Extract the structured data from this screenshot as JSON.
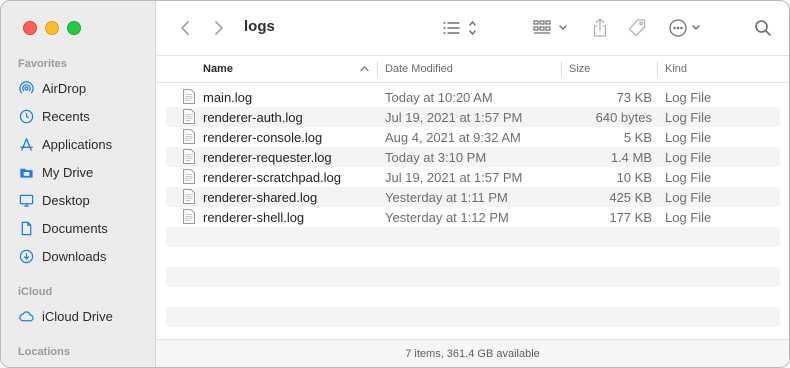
{
  "sidebar": {
    "favorites_title": "Favorites",
    "items": [
      {
        "label": "AirDrop",
        "icon": "airdrop-icon"
      },
      {
        "label": "Recents",
        "icon": "clock-icon"
      },
      {
        "label": "Applications",
        "icon": "applications-icon"
      },
      {
        "label": "My Drive",
        "icon": "folder-icon"
      },
      {
        "label": "Desktop",
        "icon": "desktop-icon"
      },
      {
        "label": "Documents",
        "icon": "document-icon"
      },
      {
        "label": "Downloads",
        "icon": "download-icon"
      }
    ],
    "icloud_title": "iCloud",
    "icloud_items": [
      {
        "label": "iCloud Drive",
        "icon": "cloud-icon"
      }
    ],
    "locations_title": "Locations"
  },
  "toolbar": {
    "title": "logs"
  },
  "columns": {
    "name": "Name",
    "date": "Date Modified",
    "size": "Size",
    "kind": "Kind"
  },
  "files": [
    {
      "name": "main.log",
      "date": "Today at 10:20 AM",
      "size": "73 KB",
      "kind": "Log File"
    },
    {
      "name": "renderer-auth.log",
      "date": "Jul 19, 2021 at 1:57 PM",
      "size": "640 bytes",
      "kind": "Log File"
    },
    {
      "name": "renderer-console.log",
      "date": "Aug 4, 2021 at 9:32 AM",
      "size": "5 KB",
      "kind": "Log File"
    },
    {
      "name": "renderer-requester.log",
      "date": "Today at 3:10 PM",
      "size": "1.4 MB",
      "kind": "Log File"
    },
    {
      "name": "renderer-scratchpad.log",
      "date": "Jul 19, 2021 at 1:57 PM",
      "size": "10 KB",
      "kind": "Log File"
    },
    {
      "name": "renderer-shared.log",
      "date": "Yesterday at 1:11 PM",
      "size": "425 KB",
      "kind": "Log File"
    },
    {
      "name": "renderer-shell.log",
      "date": "Yesterday at 1:12 PM",
      "size": "177 KB",
      "kind": "Log File"
    }
  ],
  "status": "7 items, 361.4 GB available",
  "colors": {
    "accent": "#1a7cf0",
    "close": "#fe5f57",
    "minimize": "#febc2e",
    "maximize": "#28c840"
  }
}
